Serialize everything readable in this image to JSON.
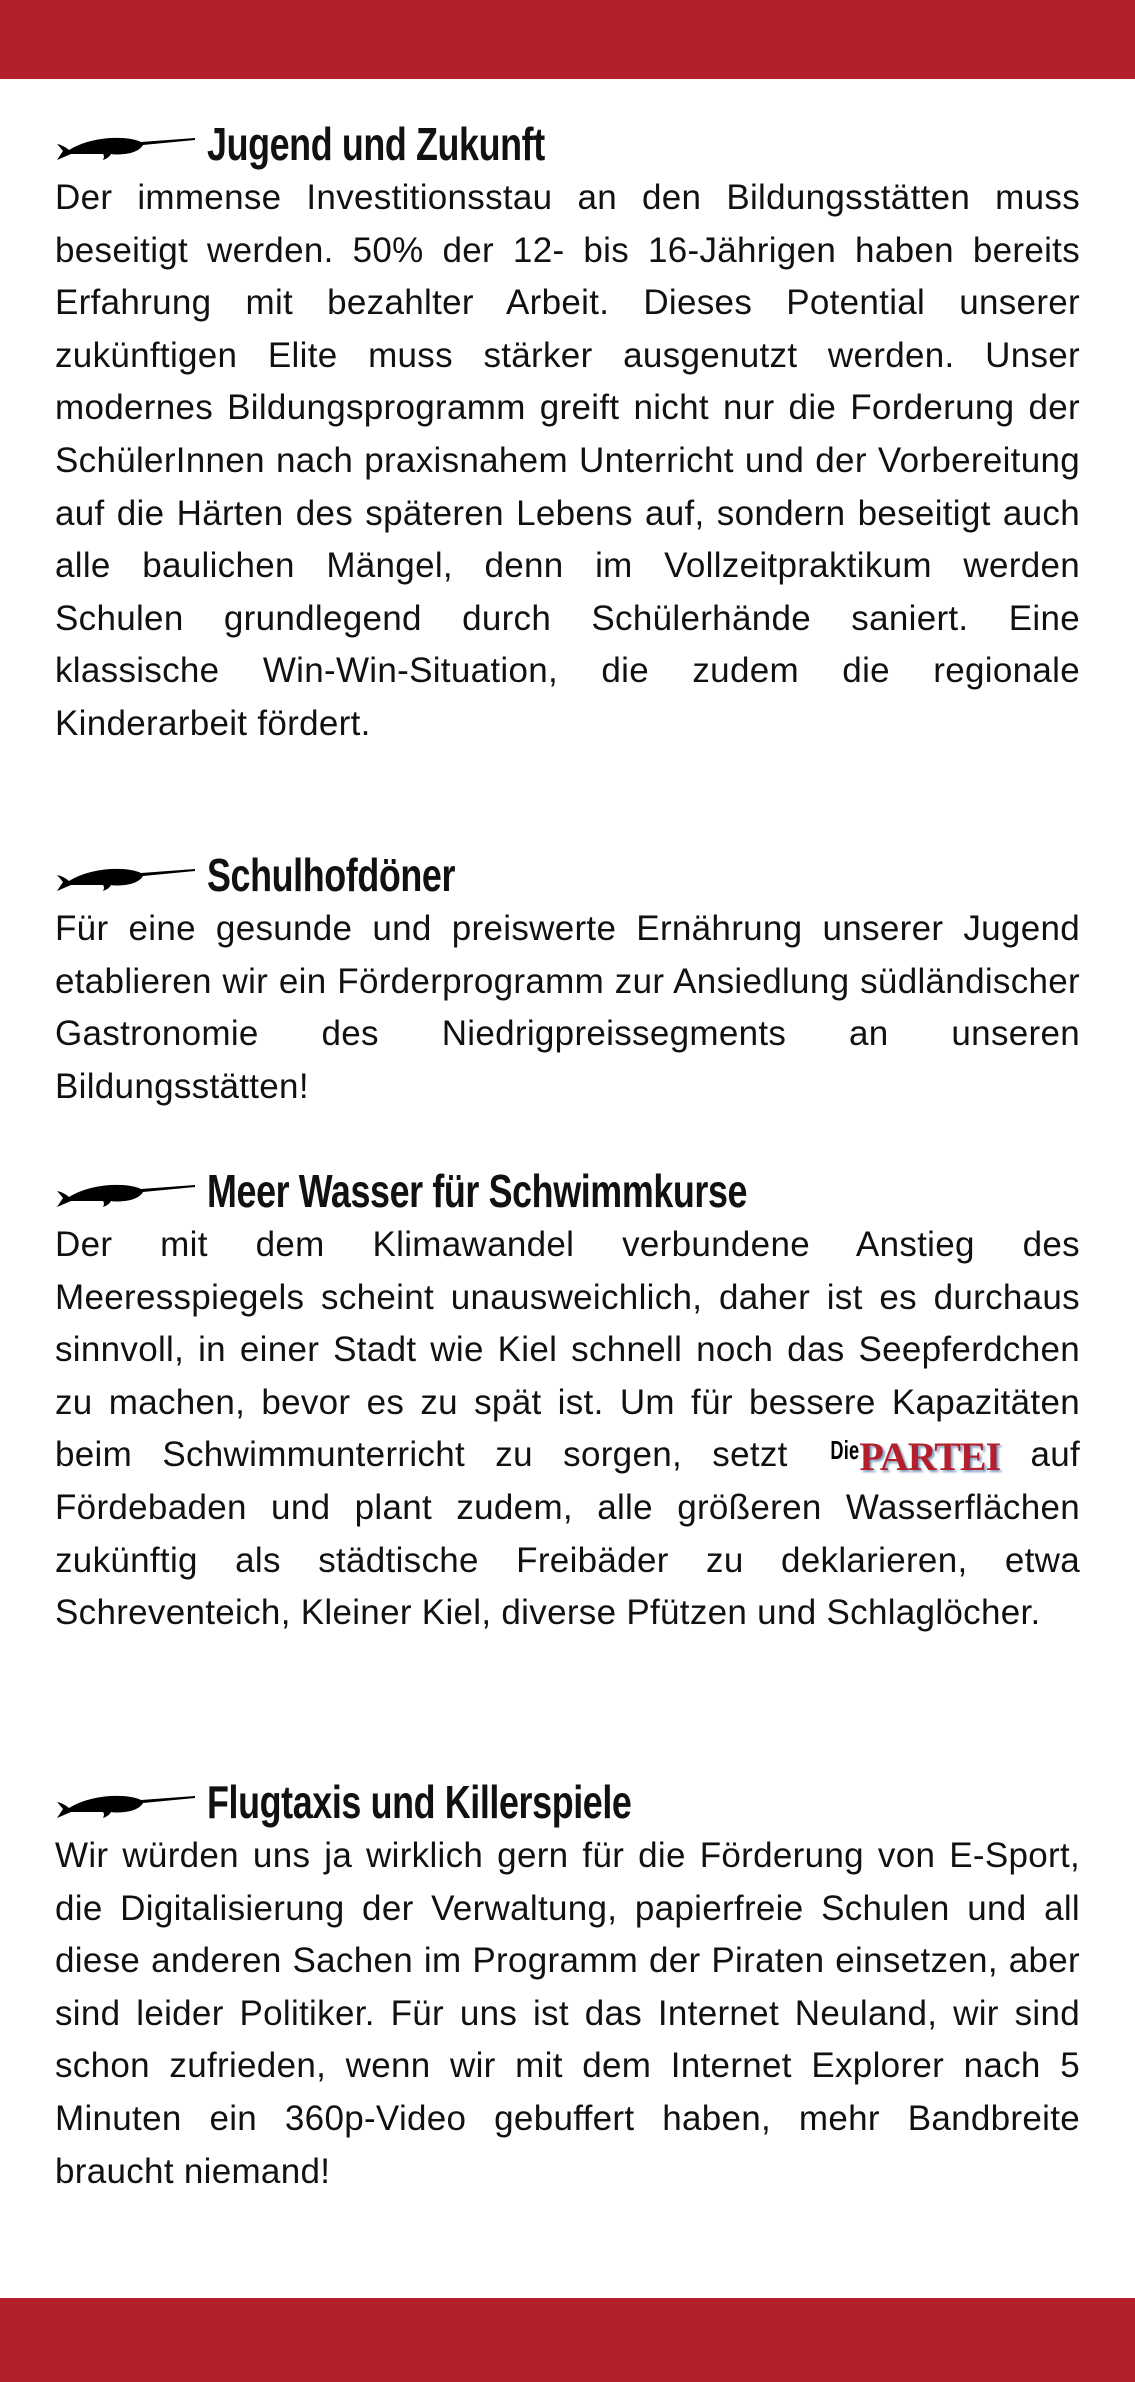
{
  "colors": {
    "brand_red": "#b41f2c"
  },
  "icon": "narwhal-icon",
  "sections": [
    {
      "title": "Jugend und Zukunft",
      "text": "Der immense Investitionsstau an den Bildungsstätten muss beseitigt werden. 50% der 12- bis 16-Jährigen haben bereits Erfahrung mit bezahlter Arbeit. Dieses Potential unserer zukünftigen Elite muss stärker ausgenutzt werden. Unser modernes Bildungsprogramm greift nicht nur die Forderung der SchülerInnen nach praxisnahem Unterricht und der Vorbereitung auf die Härten des späteren Lebens auf, sondern beseitigt auch alle baulichen Mängel, denn im Vollzeitpraktikum werden Schulen grundlegend durch Schülerhände saniert. Eine klassische Win-Win-Situation, die zudem die regionale Kinderarbeit fördert."
    },
    {
      "title": "Schulhofdöner",
      "text": "Für eine gesunde und preiswerte Ernährung unserer Jugend etablieren wir ein Förderprogramm zur Ansiedlung südländischer Gastronomie des Niedrigpreissegments an unseren Bildungsstätten!"
    },
    {
      "title": "Meer Wasser für Schwimmkurse",
      "text_before": "Der mit dem Klimawandel verbundene Anstieg des Meeresspiegels scheint unausweichlich, daher ist es durchaus sinnvoll, in einer Stadt wie Kiel schnell noch das Seepferdchen zu machen, bevor es zu spät ist. Um für bessere Kapazitäten beim Schwimmunterricht zu sorgen, setzt",
      "logo_die": "Die",
      "logo_partei": "PARTEI",
      "text_after": "auf Fördebaden und plant zudem, alle größeren Wasserflächen zukünftig als städtische Freibäder zu deklarieren, etwa Schreventeich, Kleiner Kiel, diverse Pfützen und Schlaglöcher."
    },
    {
      "title": "Flugtaxis und Killerspiele",
      "text": "Wir würden uns ja wirklich gern für die Förderung von E-Sport, die Digitalisierung der Verwaltung, papierfreie Schulen und all diese anderen Sachen im Programm der Piraten einsetzen, aber sind leider Politiker. Für uns ist das Internet Neuland, wir sind schon zufrieden, wenn wir mit dem Internet Explorer nach 5 Minuten ein 360p-Video gebuffert haben, mehr Bandbreite braucht niemand!"
    }
  ]
}
